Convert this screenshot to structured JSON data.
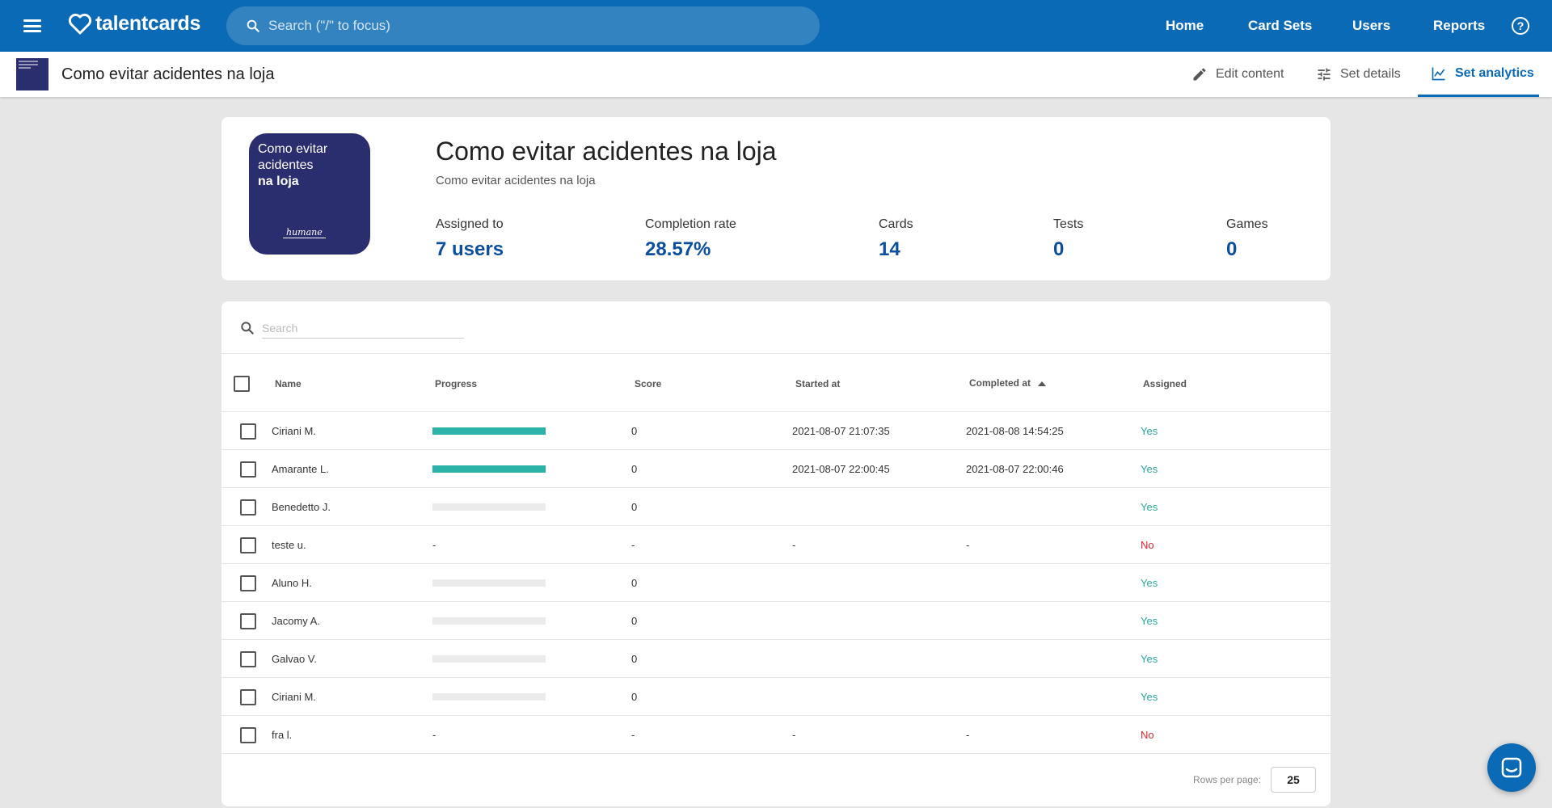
{
  "header": {
    "brand": "talentcards",
    "search_placeholder": "Search (\"/\" to focus)",
    "nav": [
      "Home",
      "Card Sets",
      "Users",
      "Reports"
    ],
    "help_glyph": "?"
  },
  "subheader": {
    "title": "Como evitar acidentes na loja",
    "tabs": [
      "Edit content",
      "Set details",
      "Set analytics"
    ],
    "active_tab": "Set analytics"
  },
  "summary": {
    "cover_line1": "Como evitar",
    "cover_line2": "acidentes",
    "cover_line3": "na loja",
    "cover_signature": "humane",
    "title": "Como evitar acidentes na loja",
    "description": "Como evitar acidentes na loja",
    "stats": [
      {
        "label": "Assigned to",
        "value": "7 users"
      },
      {
        "label": "Completion rate",
        "value": "28.57%"
      },
      {
        "label": "Cards",
        "value": "14"
      },
      {
        "label": "Tests",
        "value": "0"
      },
      {
        "label": "Games",
        "value": "0"
      }
    ]
  },
  "table": {
    "search_placeholder": "Search",
    "columns": [
      "Name",
      "Progress",
      "Score",
      "Started at",
      "Completed at",
      "Assigned"
    ],
    "sorted_column": "Completed at",
    "rows": [
      {
        "name": "Ciriani M.",
        "progress": 1.0,
        "progress_text": "",
        "score": "0",
        "started": "2021-08-07 21:07:35",
        "completed": "2021-08-08 14:54:25",
        "assigned": "Yes"
      },
      {
        "name": "Amarante L.",
        "progress": 1.0,
        "progress_text": "",
        "score": "0",
        "started": "2021-08-07 22:00:45",
        "completed": "2021-08-07 22:00:46",
        "assigned": "Yes"
      },
      {
        "name": "Benedetto J.",
        "progress": 0,
        "progress_text": "",
        "score": "0",
        "started": "",
        "completed": "",
        "assigned": "Yes"
      },
      {
        "name": "teste u.",
        "progress": null,
        "progress_text": "-",
        "score": "-",
        "started": "-",
        "completed": "-",
        "assigned": "No"
      },
      {
        "name": "Aluno H.",
        "progress": 0,
        "progress_text": "",
        "score": "0",
        "started": "",
        "completed": "",
        "assigned": "Yes"
      },
      {
        "name": "Jacomy A.",
        "progress": 0,
        "progress_text": "",
        "score": "0",
        "started": "",
        "completed": "",
        "assigned": "Yes"
      },
      {
        "name": "Galvao V.",
        "progress": 0,
        "progress_text": "",
        "score": "0",
        "started": "",
        "completed": "",
        "assigned": "Yes"
      },
      {
        "name": "Ciriani M.",
        "progress": 0,
        "progress_text": "",
        "score": "0",
        "started": "",
        "completed": "",
        "assigned": "Yes"
      },
      {
        "name": "fra l.",
        "progress": null,
        "progress_text": "-",
        "score": "-",
        "started": "-",
        "completed": "-",
        "assigned": "No"
      }
    ],
    "rows_per_page_label": "Rows per page:",
    "rows_per_page": "25"
  },
  "colors": {
    "primary": "#0b6ab5",
    "accent_teal": "#2bb3a8",
    "no_red": "#e0262e",
    "cover_navy": "#2a2d6e"
  }
}
